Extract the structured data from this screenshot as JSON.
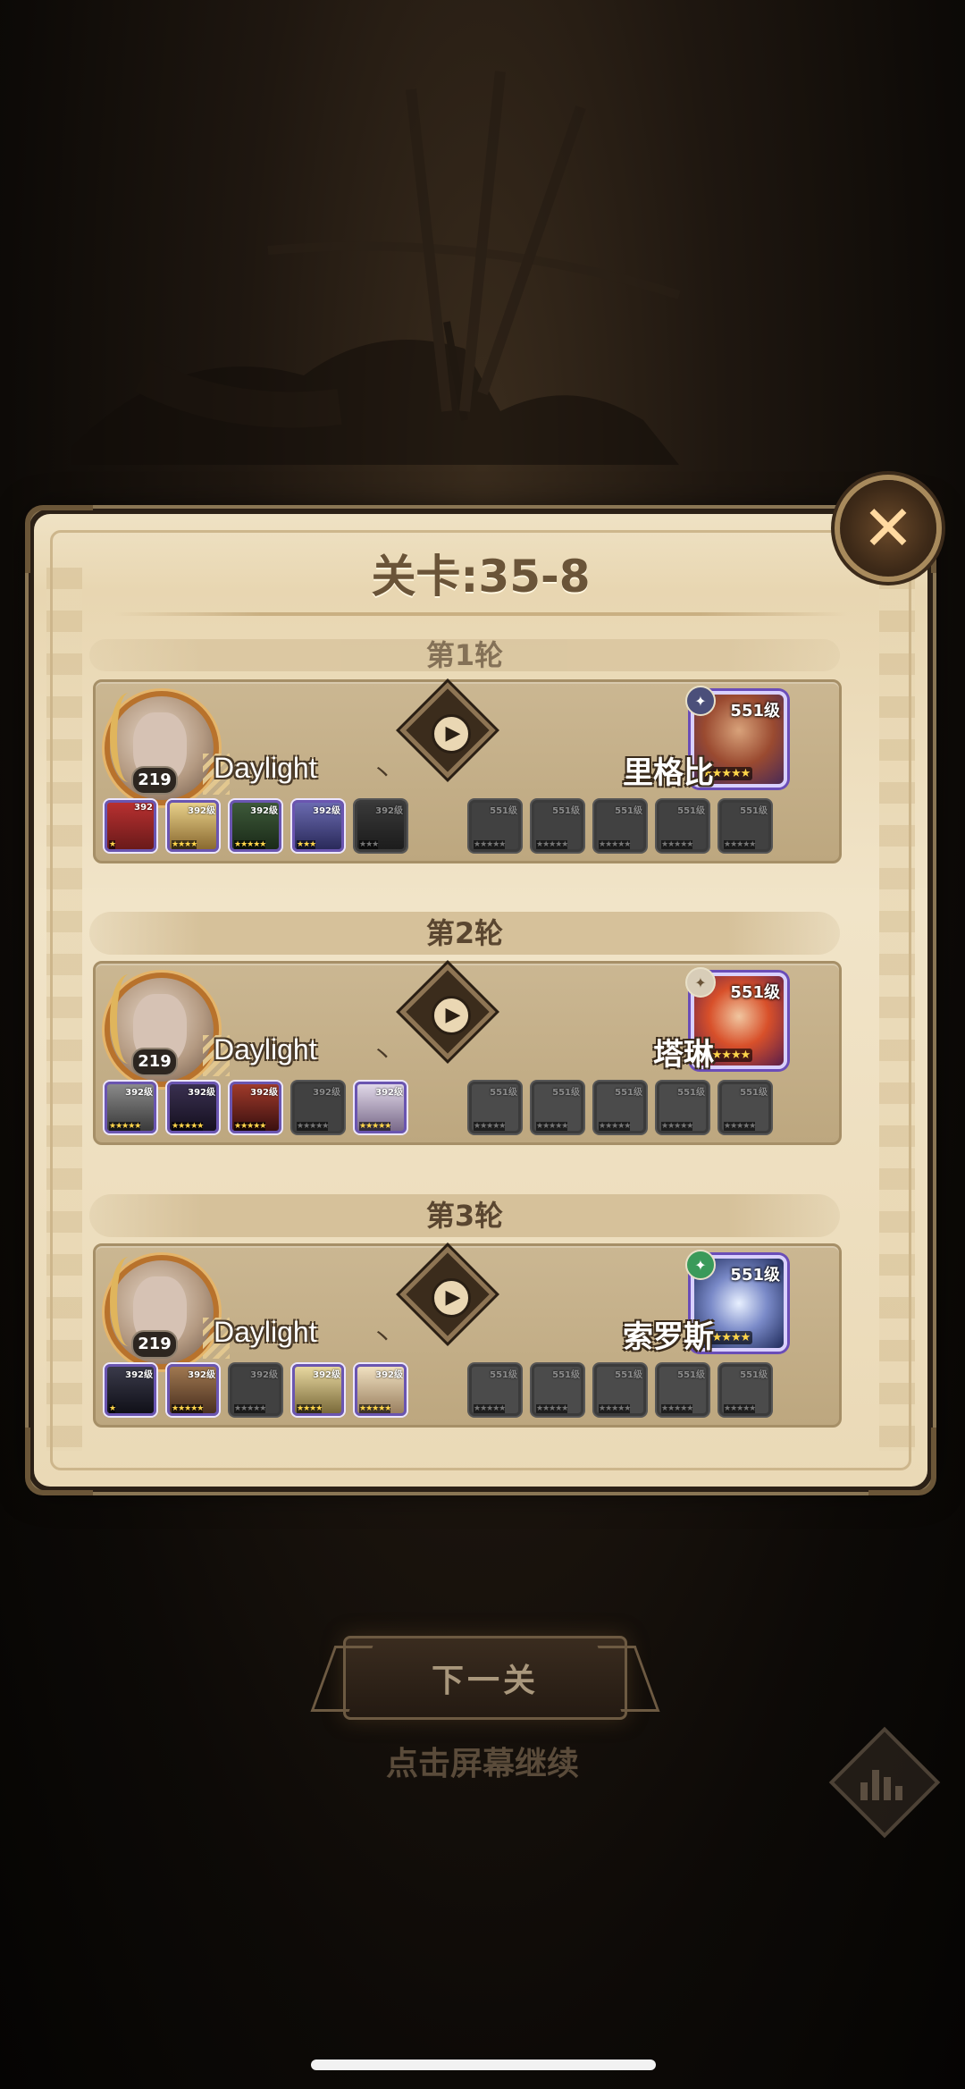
{
  "stage": {
    "title": "关卡:35-8"
  },
  "player": {
    "name": "Daylight",
    "name_mark": "丶",
    "level": "219"
  },
  "rounds": [
    {
      "label": "第1轮",
      "enemy": {
        "name": "里格比",
        "level": "551级",
        "faction": "✦",
        "stars": "★★★★★"
      },
      "ally_heroes": [
        {
          "level": "392",
          "stars": "★"
        },
        {
          "level": "392级",
          "stars": "★★★★"
        },
        {
          "level": "392级",
          "stars": "★★★★★"
        },
        {
          "level": "392级",
          "stars": "★★★"
        },
        {
          "level": "392级",
          "stars": "★★★"
        }
      ],
      "enemy_heroes": [
        {
          "level": "551级",
          "stars": "★★★★★"
        },
        {
          "level": "551级",
          "stars": "★★★★★"
        },
        {
          "level": "551级",
          "stars": "★★★★★"
        },
        {
          "level": "551级",
          "stars": "★★★★★"
        },
        {
          "level": "551级",
          "stars": "★★★★★"
        }
      ]
    },
    {
      "label": "第2轮",
      "enemy": {
        "name": "塔琳",
        "level": "551级",
        "faction": "✦",
        "stars": "★★★★★"
      },
      "ally_heroes": [
        {
          "level": "392级",
          "stars": "★★★★★"
        },
        {
          "level": "392级",
          "stars": "★★★★★"
        },
        {
          "level": "392级",
          "stars": "★★★★★"
        },
        {
          "level": "392级",
          "stars": "★★★★★"
        },
        {
          "level": "392级",
          "stars": "★★★★★"
        }
      ],
      "enemy_heroes": [
        {
          "level": "551级",
          "stars": "★★★★★"
        },
        {
          "level": "551级",
          "stars": "★★★★★"
        },
        {
          "level": "551级",
          "stars": "★★★★★"
        },
        {
          "level": "551级",
          "stars": "★★★★★"
        },
        {
          "level": "551级",
          "stars": "★★★★★"
        }
      ]
    },
    {
      "label": "第3轮",
      "enemy": {
        "name": "索罗斯",
        "level": "551级",
        "faction": "✦",
        "stars": "★★★★★"
      },
      "ally_heroes": [
        {
          "level": "392级",
          "stars": "★"
        },
        {
          "level": "392级",
          "stars": "★★★★★"
        },
        {
          "level": "392级",
          "stars": "★★★★★"
        },
        {
          "level": "392级",
          "stars": "★★★★"
        },
        {
          "level": "392级",
          "stars": "★★★★★"
        }
      ],
      "enemy_heroes": [
        {
          "level": "551级",
          "stars": "★★★★★"
        },
        {
          "level": "551级",
          "stars": "★★★★★"
        },
        {
          "level": "551级",
          "stars": "★★★★★"
        },
        {
          "level": "551级",
          "stars": "★★★★★"
        },
        {
          "level": "551级",
          "stars": "★★★★★"
        }
      ]
    }
  ],
  "buttons": {
    "close": "✕",
    "next": "下一关",
    "tap_hint": "点击屏幕继续"
  },
  "colors": {
    "panel": "#efe2c4",
    "accent": "#6a5438",
    "frame": "#8a7654",
    "background": "#0d0a07"
  }
}
